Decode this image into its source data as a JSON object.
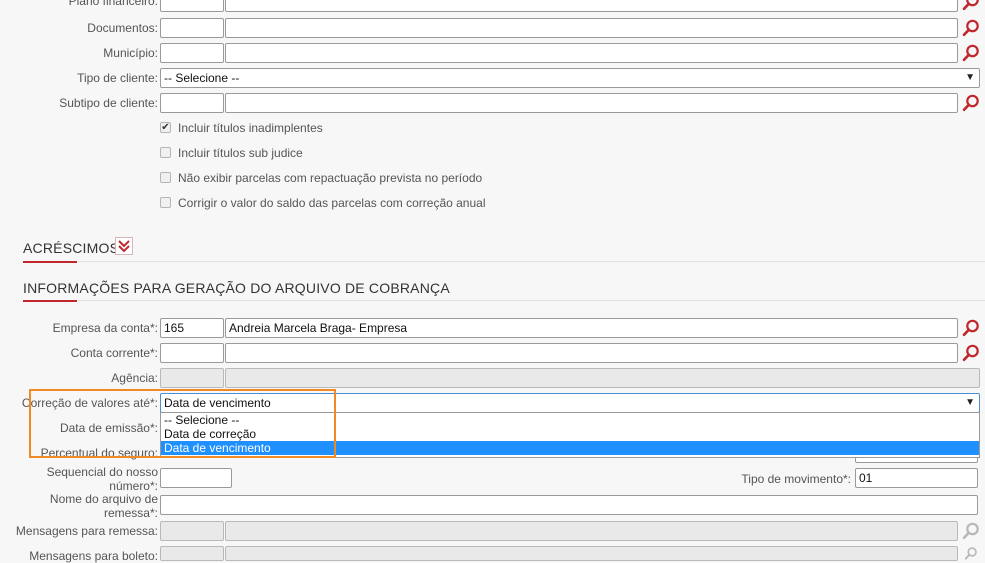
{
  "fields": {
    "plano_financeiro": {
      "label": "Plano financeiro:"
    },
    "documentos": {
      "label": "Documentos:"
    },
    "municipio": {
      "label": "Município:"
    },
    "tipo_cliente": {
      "label": "Tipo de cliente:",
      "value": "-- Selecione --"
    },
    "subtipo_cliente": {
      "label": "Subtipo de cliente:"
    }
  },
  "checkboxes": [
    {
      "label": "Incluir títulos inadimplentes",
      "checked": true
    },
    {
      "label": "Incluir títulos sub judice",
      "checked": false
    },
    {
      "label": "Não exibir parcelas com repactuação prevista no período",
      "checked": false
    },
    {
      "label": "Corrigir o valor do saldo das parcelas com correção anual",
      "checked": false
    }
  ],
  "sections": {
    "acrescimos": "ACRÉSCIMOS",
    "cobranca": "INFORMAÇÕES PARA GERAÇÃO DO ARQUIVO DE COBRANÇA"
  },
  "cobranca": {
    "empresa": {
      "label": "Empresa da conta*:",
      "code": "165",
      "name": "Andreia Marcela Braga- Empresa"
    },
    "conta_corrente": {
      "label": "Conta corrente*:"
    },
    "agencia": {
      "label": "Agência:"
    },
    "correcao": {
      "label": "Correção de valores até*:",
      "value": "Data de vencimento",
      "options": [
        "-- Selecione --",
        "Data de correção",
        "Data de vencimento"
      ],
      "selected_index": 2
    },
    "data_emissao": {
      "label": "Data de emissão*:"
    },
    "percentual_seguro": {
      "label": "Percentual do seguro:"
    },
    "sequencial": {
      "label": "Sequencial do nosso número*:"
    },
    "tipo_movimento": {
      "label": "Tipo de movimento*:",
      "value": "01"
    },
    "nome_arquivo": {
      "label": "Nome do arquivo de remessa*:"
    },
    "msg_remessa": {
      "label": "Mensagens para remessa:"
    },
    "msg_boleto": {
      "label": "Mensagens para boleto:"
    }
  },
  "icons": {
    "search": "search-icon",
    "expand": "double-chevron-down-icon",
    "checkmark": "✔"
  },
  "colors": {
    "accent": "#c0272d",
    "highlight": "#f08a24",
    "selected_option": "#1e90ff"
  }
}
